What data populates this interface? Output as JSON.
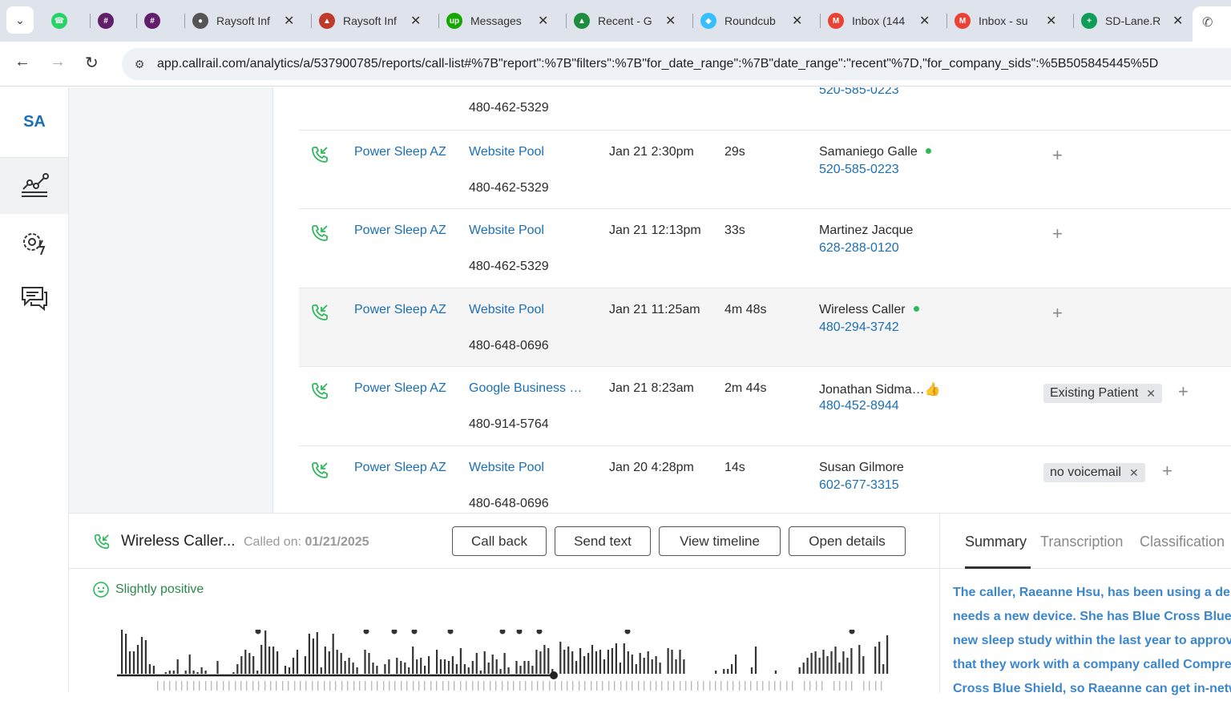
{
  "browser": {
    "tabs": [
      {
        "title": "",
        "icon": "whatsapp-icon",
        "color": "#25d366"
      },
      {
        "title": "",
        "icon": "slack-icon",
        "color": "#611f69"
      },
      {
        "title": "",
        "icon": "slack-icon",
        "color": "#611f69"
      },
      {
        "title": "Raysoft Inf",
        "icon": "globe-icon",
        "color": "#555555"
      },
      {
        "title": "Raysoft Inf",
        "icon": "school-icon",
        "color": "#c0392b"
      },
      {
        "title": "Messages",
        "icon": "upwork-icon",
        "color": "#14a800"
      },
      {
        "title": "Recent - G",
        "icon": "google-drive-icon",
        "color": "#1e8e3e"
      },
      {
        "title": "Roundcub",
        "icon": "roundcube-icon",
        "color": "#37beff"
      },
      {
        "title": "Inbox (144",
        "icon": "gmail-icon",
        "color": "#ea4335"
      },
      {
        "title": "Inbox - su",
        "icon": "gmail-icon",
        "color": "#ea4335"
      },
      {
        "title": "SD-Lane.R",
        "icon": "sheets-icon",
        "color": "#0f9d58"
      }
    ],
    "url": "app.callrail.com/analytics/a/537900785/reports/call-list#%7B\"report\":%7B\"filters\":%7B\"for_date_range\":%7B\"date_range\":\"recent\"%7D,\"for_company_sids\":%5B505845445%5D"
  },
  "sidebar": {
    "brand": "SA",
    "items": [
      {
        "name": "analytics-icon",
        "active": true
      },
      {
        "name": "settings-automation-icon",
        "active": false
      },
      {
        "name": "conversations-icon",
        "active": false
      }
    ]
  },
  "partial_row": {
    "number": "480-462-5329",
    "caller_phone": "520-585-0223"
  },
  "calls": [
    {
      "company": "Power Sleep AZ",
      "source": "Website Pool",
      "tracking_number": "480-462-5329",
      "time": "Jan 21 2:30pm",
      "duration": "29s",
      "caller": "Samaniego Galle",
      "caller_phone": "520-585-0223",
      "dot": true,
      "tags": []
    },
    {
      "company": "Power Sleep AZ",
      "source": "Website Pool",
      "tracking_number": "480-462-5329",
      "time": "Jan 21 12:13pm",
      "duration": "33s",
      "caller": "Martinez Jacque",
      "caller_phone": "628-288-0120",
      "dot": false,
      "tags": []
    },
    {
      "company": "Power Sleep AZ",
      "source": "Website Pool",
      "tracking_number": "480-648-0696",
      "time": "Jan 21 11:25am",
      "duration": "4m 48s",
      "caller": "Wireless Caller",
      "caller_phone": "480-294-3742",
      "dot": true,
      "tags": [],
      "highlighted": true
    },
    {
      "company": "Power Sleep AZ",
      "source": "Google Business …",
      "tracking_number": "480-914-5764",
      "time": "Jan 21 8:23am",
      "duration": "2m 44s",
      "caller": "Jonathan Sidma…",
      "caller_phone": "480-452-8944",
      "dot": false,
      "thumb": true,
      "tags": [
        "Existing Patient"
      ]
    },
    {
      "company": "Power Sleep AZ",
      "source": "Website Pool",
      "tracking_number": "480-648-0696",
      "time": "Jan 20 4:28pm",
      "duration": "14s",
      "caller": "Susan Gilmore",
      "caller_phone": "602-677-3315",
      "dot": false,
      "tags": [
        "no voicemail"
      ]
    }
  ],
  "detail": {
    "caller": "Wireless Caller...",
    "called_on_label": "Called on:",
    "called_on_date": "01/21/2025",
    "buttons": {
      "call_back": "Call back",
      "send_text": "Send text",
      "view_timeline": "View timeline",
      "open_details": "Open details"
    },
    "sentiment": "Slightly positive",
    "tabs": [
      "Summary",
      "Transcription",
      "Classification"
    ],
    "summary_lines": [
      "The caller, Raeanne Hsu, has been using a dent",
      "needs a new device. She has Blue Cross Blue Sh",
      "new sleep study within the last year to approve",
      "that they work with a company called Compreh",
      "Cross Blue Shield, so Raeanne can get in-netw"
    ],
    "waveform": [
      56,
      50,
      28,
      28,
      36,
      46,
      42,
      12,
      10,
      0,
      0,
      2,
      4,
      4,
      18,
      0,
      4,
      24,
      4,
      2,
      8,
      4,
      0,
      0,
      16,
      0,
      0,
      0,
      2,
      12,
      22,
      30,
      26,
      22,
      4,
      36,
      54,
      34,
      34,
      28,
      0,
      10,
      8,
      20,
      30,
      0,
      22,
      50,
      44,
      52,
      8,
      34,
      28,
      50,
      30,
      26,
      16,
      20,
      14,
      8,
      0,
      30,
      26,
      14,
      10,
      0,
      12,
      18,
      0,
      20,
      16,
      14,
      8,
      34,
      18,
      20,
      10,
      22,
      0,
      30,
      18,
      18,
      16,
      22,
      12,
      32,
      12,
      8,
      16,
      26,
      4,
      28,
      14,
      24,
      18,
      6,
      26,
      8,
      0,
      16,
      10,
      16,
      16,
      10,
      30,
      28,
      36,
      32,
      6,
      0,
      40,
      30,
      34,
      28,
      16,
      32,
      22,
      26,
      36,
      28,
      30,
      18,
      30,
      32,
      38,
      14,
      38,
      28,
      24,
      12,
      26,
      20,
      28,
      18,
      22,
      14,
      0,
      32,
      30,
      18,
      30,
      18,
      0,
      0,
      0,
      0,
      0,
      0,
      0,
      4,
      0,
      6,
      6,
      12,
      24,
      0,
      0,
      0,
      8,
      34,
      0,
      0,
      0,
      0,
      4,
      0,
      0,
      0,
      0,
      0,
      8,
      14,
      20,
      26,
      28,
      20,
      30,
      22,
      28,
      34,
      14,
      28,
      20,
      32,
      0,
      36,
      22,
      0,
      0,
      34,
      40,
      12,
      48
    ]
  }
}
